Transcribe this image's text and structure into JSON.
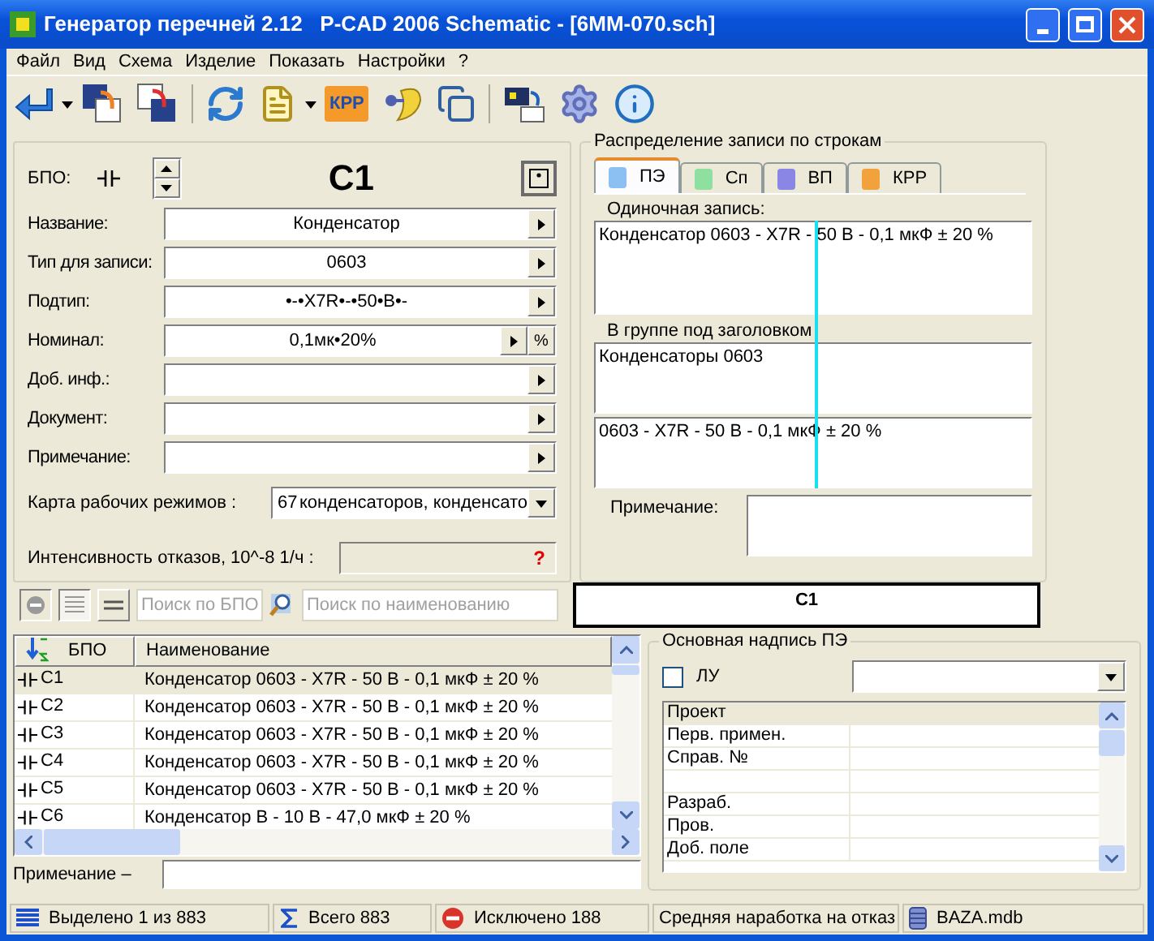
{
  "window": {
    "title": "Генератор перечней 2.12   P-CAD 2006 Schematic - [6MM-070.sch]"
  },
  "menu": [
    "Файл",
    "Вид",
    "Схема",
    "Изделие",
    "Показать",
    "Настройки",
    "?"
  ],
  "toolbar": {
    "krr_label": "КРР"
  },
  "component": {
    "bpo_label": "БПО:",
    "designator": "C1",
    "fields": [
      {
        "label": "Название:",
        "value": "Конденсатор"
      },
      {
        "label": "Тип для записи:",
        "value": "0603"
      },
      {
        "label": "Подтип:",
        "value": "•-•X7R•-•50•В•-"
      },
      {
        "label": "Номинал:",
        "value": "0,1мк•20%",
        "extra_button": "%"
      },
      {
        "label": "Доб. инф.:"
      },
      {
        "label": "Документ:"
      },
      {
        "label": "Примечание:"
      }
    ],
    "mode_map": {
      "label": "Карта рабочих режимов :",
      "code": "67",
      "text": "конденсаторов, конденсато"
    },
    "failure_rate": {
      "label": "Интенсивность отказов, 10^-8 1/ч :",
      "value": "?"
    }
  },
  "distribution": {
    "title": "Распределение записи по строкам",
    "tabs": [
      {
        "label": "ПЭ",
        "selected": true,
        "color": "#8cc0f2"
      },
      {
        "label": "Сп",
        "selected": false,
        "color": "#8fe0a0"
      },
      {
        "label": "ВП",
        "selected": false,
        "color": "#8a86e6"
      },
      {
        "label": "КРР",
        "selected": false,
        "color": "#f2a23c"
      }
    ],
    "single_label": "Одиночная запись:",
    "single_value": "Конденсатор 0603 - X7R - 50 В - 0,1 мкФ ± 20 %",
    "group_label": "В группе под заголовком",
    "group_header": "Конденсаторы 0603",
    "group_value": "0603 - X7R - 50 В - 0,1 мкФ ± 20 %",
    "note_label": "Примечание:"
  },
  "search": {
    "bpo_placeholder": "Поиск по БПО",
    "name_placeholder": "Поиск по наименованию"
  },
  "preview": "C1",
  "list": {
    "columns": [
      "БПО",
      "Наименование"
    ],
    "rows": [
      {
        "bpo": "C1",
        "name": "Конденсатор 0603 - X7R - 50 В - 0,1 мкФ ± 20 %",
        "selected": true
      },
      {
        "bpo": "C2",
        "name": "Конденсатор 0603 - X7R - 50 В - 0,1 мкФ ± 20 %",
        "selected": false
      },
      {
        "bpo": "C3",
        "name": "Конденсатор 0603 - X7R - 50 В - 0,1 мкФ ± 20 %",
        "selected": false
      },
      {
        "bpo": "C4",
        "name": "Конденсатор 0603 - X7R - 50 В - 0,1 мкФ ± 20 %",
        "selected": false
      },
      {
        "bpo": "C5",
        "name": "Конденсатор 0603 - X7R - 50 В - 0,1 мкФ ± 20 %",
        "selected": false
      },
      {
        "bpo": "C6",
        "name": "Конденсатор B - 10 В - 47,0 мкФ ± 20 %",
        "selected": false
      }
    ]
  },
  "note": {
    "label": "Примечание –"
  },
  "title_block": {
    "title": "Основная надпись ПЭ",
    "lu": {
      "label": "ЛУ",
      "checked": false
    },
    "rows": [
      {
        "kind": "text",
        "label": "Проект",
        "selected": true
      },
      {
        "kind": "text",
        "label": "Перв. примен.",
        "selected": false
      },
      {
        "kind": "text",
        "label": "Справ. №",
        "selected": false
      },
      {
        "kind": "blank",
        "selected": false
      },
      {
        "kind": "text",
        "label": "Разраб.",
        "selected": false
      },
      {
        "kind": "text",
        "label": "Пров.",
        "selected": false
      },
      {
        "kind": "text",
        "label": "Доб. поле",
        "selected": false
      }
    ]
  },
  "status_bar": [
    {
      "kind": "selected",
      "text": "Выделено 1 из 883"
    },
    {
      "kind": "total",
      "text": "Всего 883"
    },
    {
      "kind": "excluded",
      "text": "Исключено 188"
    },
    {
      "kind": "plain",
      "text": "Средняя наработка на отказ"
    },
    {
      "kind": "db",
      "text": "BAZA.mdb"
    }
  ]
}
